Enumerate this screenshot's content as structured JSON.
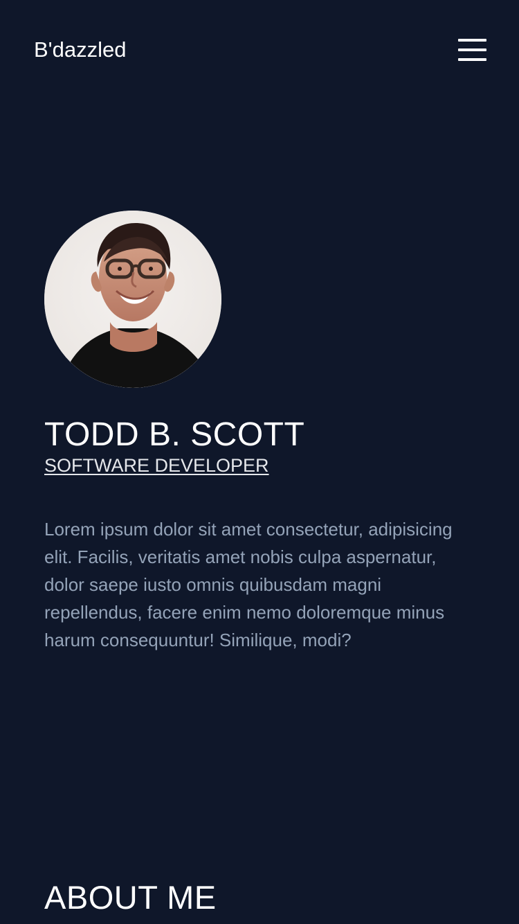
{
  "brand": {
    "name": "B'dazzled"
  },
  "menu": {
    "icon": "hamburger-menu-icon"
  },
  "profile": {
    "name": "TODD B. SCOTT",
    "role": "SOFTWARE DEVELOPER",
    "bio": "Lorem ipsum dolor sit amet consectetur, adipisicing elit. Facilis, veritatis amet nobis culpa aspernatur, dolor saepe iusto omnis quibusdam magni repellendus, facere enim nemo doloremque minus harum consequuntur! Similique, modi?",
    "avatar": {
      "icon": "profile-photo"
    }
  },
  "about": {
    "heading": "ABOUT ME"
  },
  "colors": {
    "background": "#0f172a",
    "text_primary": "#ffffff",
    "text_secondary": "#94a3b8"
  }
}
